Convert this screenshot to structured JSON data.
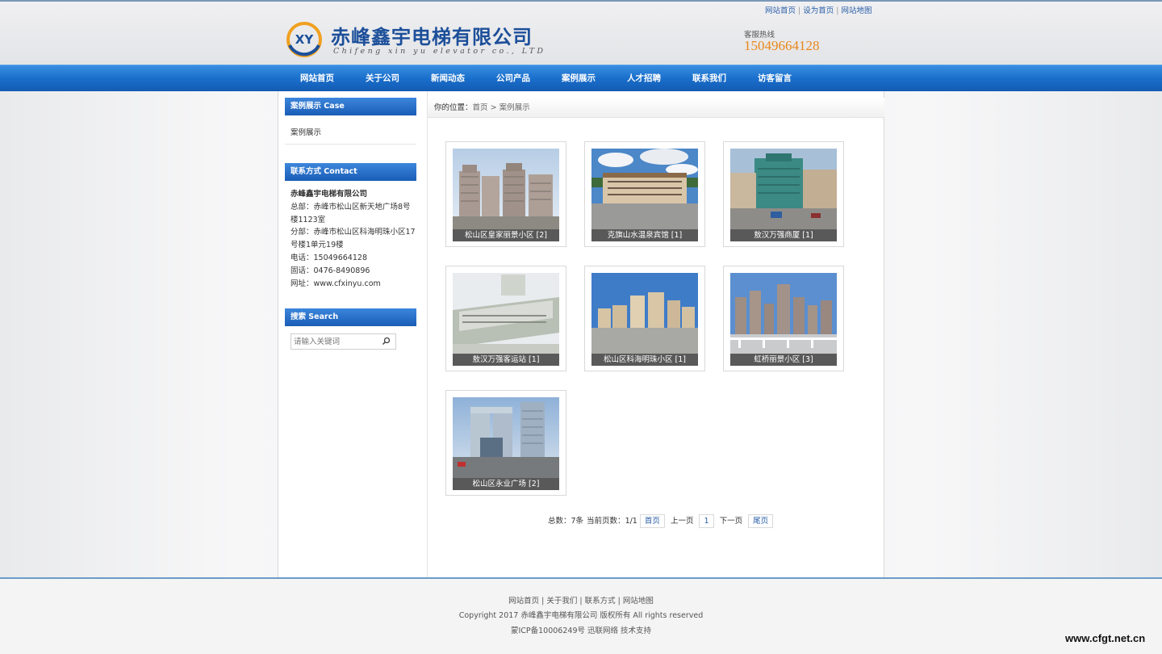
{
  "header": {
    "top_links": [
      "网站首页",
      "设为首页",
      "网站地图"
    ],
    "logo_mark_text": "XY",
    "company_name": "赤峰鑫宇电梯有限公司",
    "company_name_en": "Chifeng xin yu elevator co., LTD",
    "hotline_label": "客服热线",
    "hotline_number": "15049664128"
  },
  "nav": {
    "items": [
      "网站首页",
      "关于公司",
      "新闻动态",
      "公司产品",
      "案例展示",
      "人才招聘",
      "联系我们",
      "访客留言"
    ]
  },
  "sidebar": {
    "case_title": "案例展示 Case",
    "case_items": [
      "案例展示"
    ],
    "contact_title": "联系方式 Contact",
    "contact_lines": [
      "赤峰鑫宇电梯有限公司",
      "总部：赤峰市松山区新天地广场8号",
      "楼1123室",
      "分部：赤峰市松山区科海明珠小区17",
      "号楼1单元19楼",
      "电话：15049664128",
      "固话：0476-8490896",
      "网址：www.cfxinyu.com"
    ],
    "search_title": "搜索 Search",
    "search_placeholder": "请输入关键词"
  },
  "breadcrumb": {
    "label": "你的位置：",
    "home": "首页",
    "separator": ">",
    "current": "案例展示"
  },
  "cases": [
    {
      "caption": "松山区皇家丽景小区 [2]",
      "scene": "highrise"
    },
    {
      "caption": "克旗山水温泉宾馆 [1]",
      "scene": "hotel"
    },
    {
      "caption": "敖汉万强商厦 [1]",
      "scene": "mall"
    },
    {
      "caption": "敖汉万强客运站 [1]",
      "scene": "model"
    },
    {
      "caption": "松山区科海明珠小区 [1]",
      "scene": "skyline"
    },
    {
      "caption": "虹桥丽景小区 [3]",
      "scene": "towers"
    },
    {
      "caption": "松山区永业广场 [2]",
      "scene": "plaza"
    }
  ],
  "pager": {
    "total": "总数：7条",
    "current_page_label": "当前页数：",
    "current_page": "1/1",
    "first": "首页",
    "prev": "上一页",
    "page": "1",
    "next": "下一页",
    "last": "尾页"
  },
  "footer": {
    "links": [
      "网站首页",
      "关于我们",
      "联系方式",
      "网站地图"
    ],
    "copyright": "Copyright 2017 赤峰鑫宇电梯有限公司 版权所有 All rights reserved",
    "icp": "蒙ICP备10006249号 迅联网络 技术支持"
  },
  "watermark": "www.cfgt.net.cn",
  "colors": {
    "nav_blue": "#1a6fcc",
    "brand_blue": "#1c4f9a",
    "hotline_orange": "#e8881b"
  }
}
